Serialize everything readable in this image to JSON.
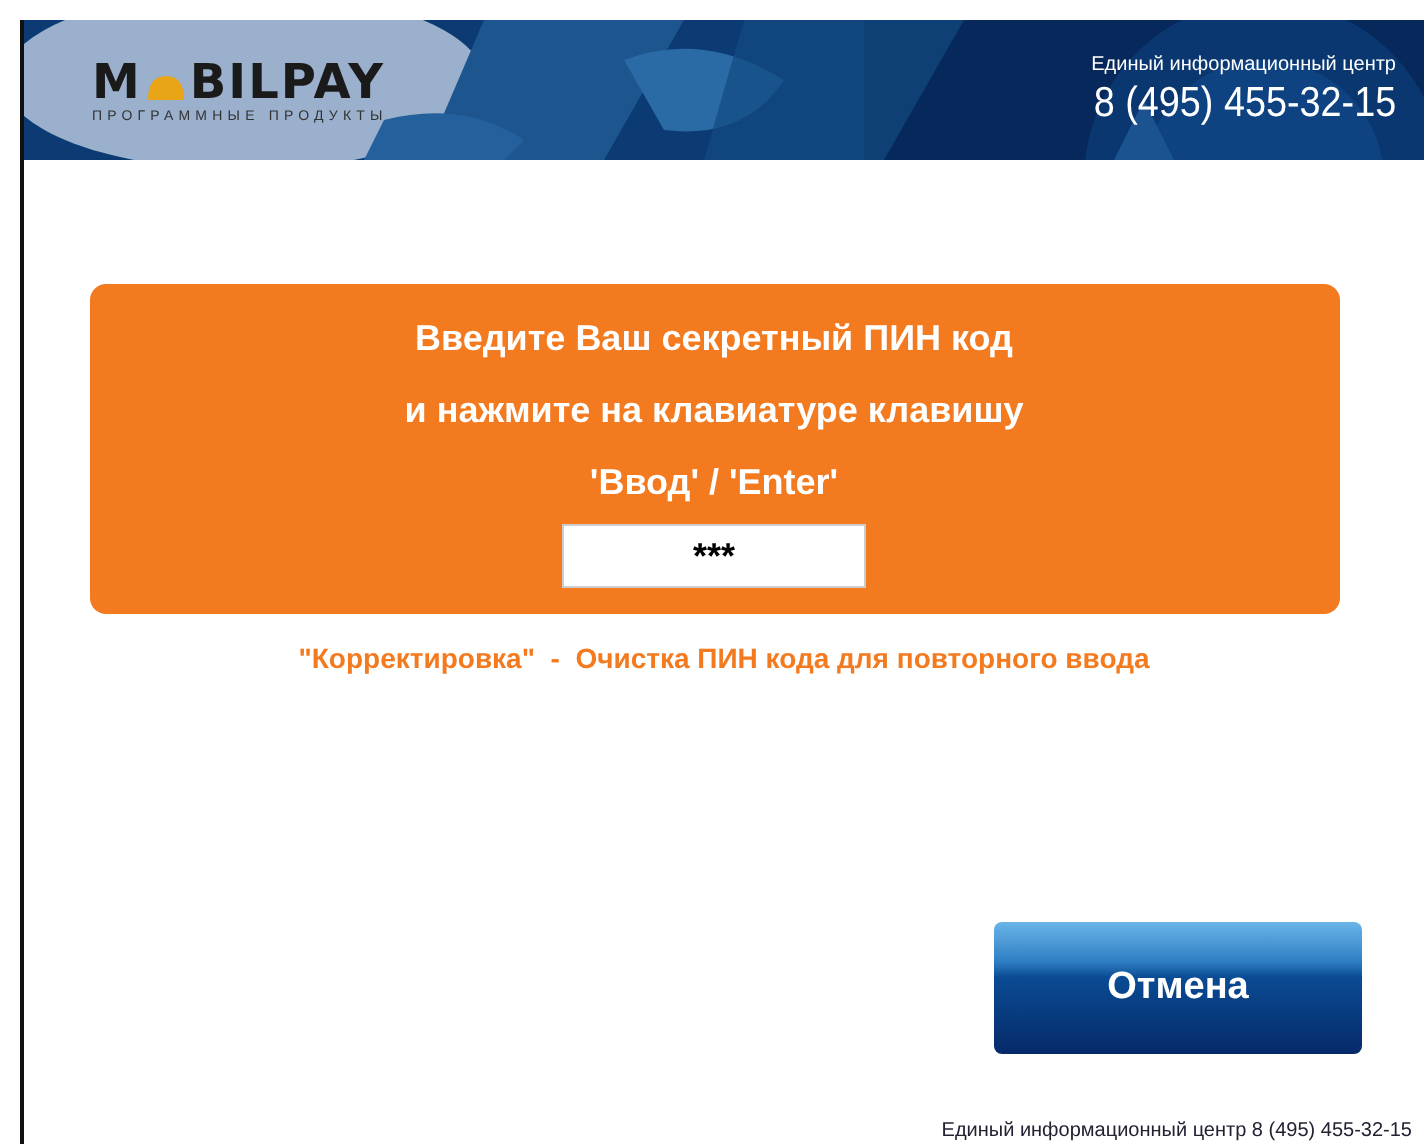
{
  "header": {
    "logo": {
      "first": "M",
      "rest": "BILPAY",
      "tagline": "ПРОГРАММНЫЕ ПРОДУКТЫ"
    },
    "hotline_label": "Единый информационный центр",
    "hotline_phone": "8 (495) 455-32-15"
  },
  "prompt": {
    "lines": [
      "Введите Ваш секретный ПИН код",
      "и нажмите на клавиатуре клавишу",
      "'Ввод' / 'Enter'"
    ],
    "pin_value": "***"
  },
  "hint": "\"Корректировка\"  -  Очистка ПИН кода для повторного ввода",
  "cancel_button": "Отмена",
  "footer": "Единый информационный центр 8 (495) 455-32-15"
}
